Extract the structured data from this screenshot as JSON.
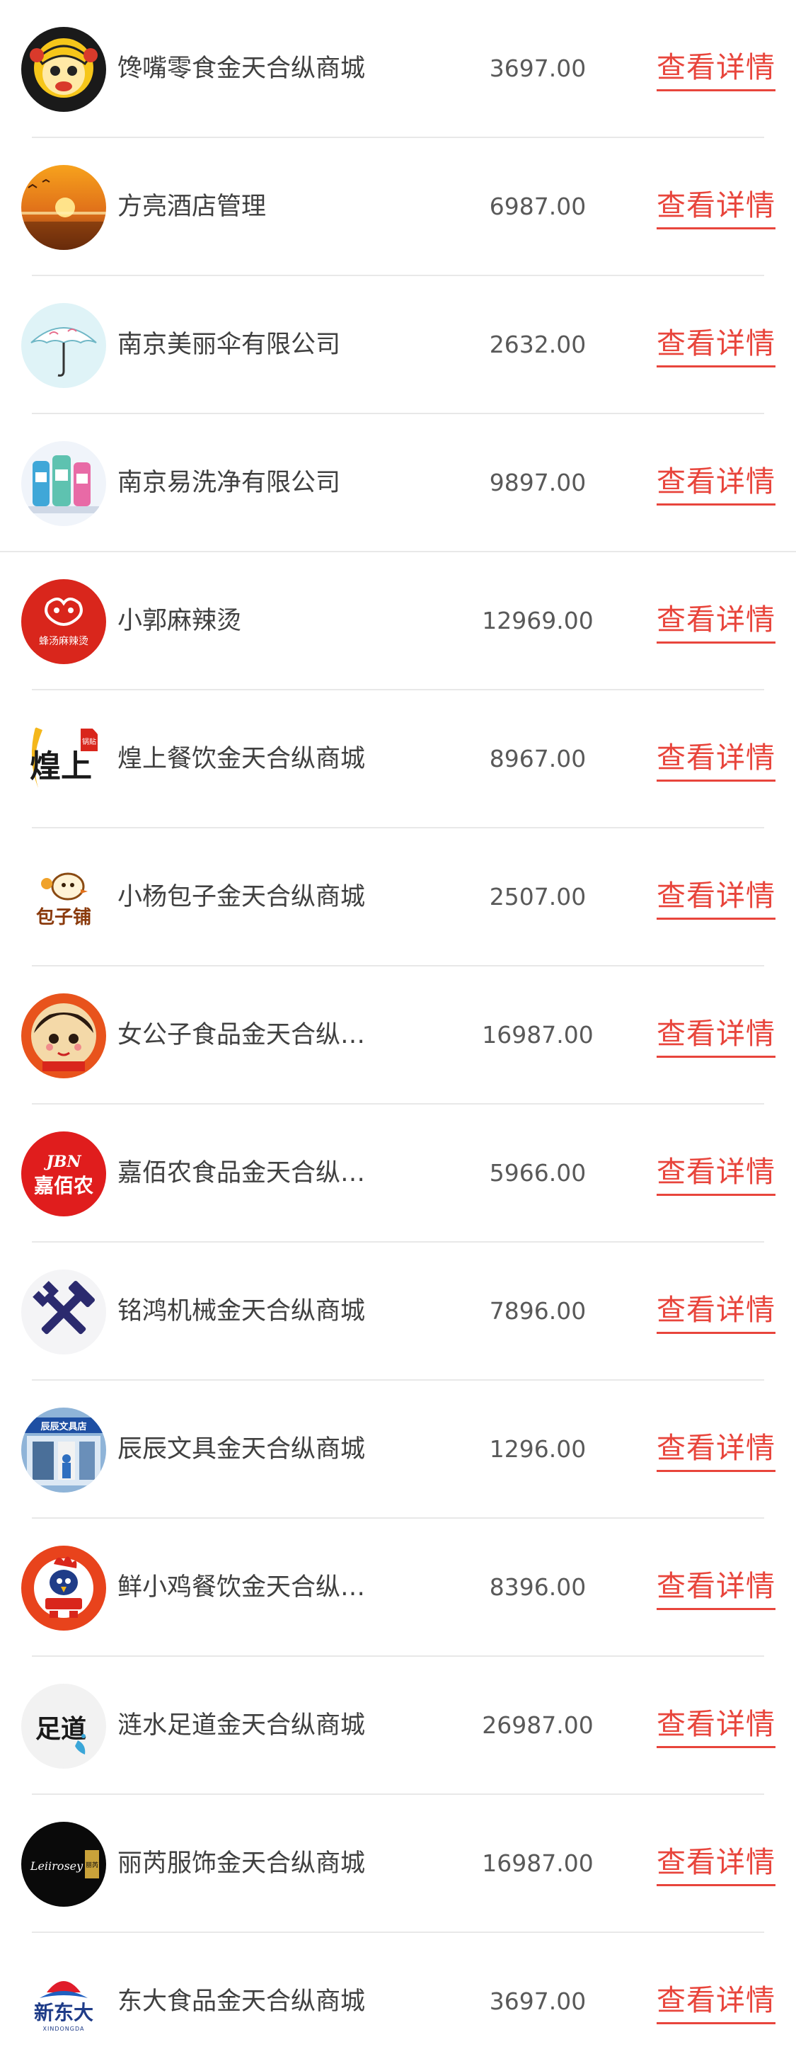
{
  "detail_label": "查看详情",
  "colors": {
    "accent": "#e8453c",
    "divider": "#e8e8e8",
    "name_text": "#404040",
    "amount_text": "#595959"
  },
  "merchants": [
    {
      "name": "馋嘴零食金天合纵商城",
      "amount": "3697.00",
      "logo": "cartoon-girl-logo"
    },
    {
      "name": "方亮酒店管理",
      "amount": "6987.00",
      "logo": "sunset-logo"
    },
    {
      "name": "南京美丽伞有限公司",
      "amount": "2632.00",
      "logo": "umbrella-logo"
    },
    {
      "name": "南京易洗净有限公司",
      "amount": "9897.00",
      "logo": "detergent-logo"
    },
    {
      "name": "小郭麻辣烫",
      "amount": "12969.00",
      "logo": "malatang-logo"
    },
    {
      "name": "煌上餐饮金天合纵商城",
      "amount": "8967.00",
      "logo": "huangshang-logo"
    },
    {
      "name": "小杨包子金天合纵商城",
      "amount": "2507.00",
      "logo": "baozi-logo"
    },
    {
      "name": "女公子食品金天合纵商城",
      "amount": "16987.00",
      "logo": "girl-face-logo"
    },
    {
      "name": "嘉佰农食品金天合纵商城",
      "amount": "5966.00",
      "logo": "jiabainong-logo"
    },
    {
      "name": "铭鸿机械金天合纵商城",
      "amount": "7896.00",
      "logo": "tools-logo"
    },
    {
      "name": "辰辰文具金天合纵商城",
      "amount": "1296.00",
      "logo": "stationery-store-logo"
    },
    {
      "name": "鲜小鸡餐饮金天合纵商城",
      "amount": "8396.00",
      "logo": "chicken-logo"
    },
    {
      "name": "涟水足道金天合纵商城",
      "amount": "26987.00",
      "logo": "foot-spa-logo"
    },
    {
      "name": "丽芮服饰金天合纵商城",
      "amount": "16987.00",
      "logo": "lirui-fashion-logo"
    },
    {
      "name": "东大食品金天合纵商城",
      "amount": "3697.00",
      "logo": "xindongda-logo"
    }
  ],
  "logo_text": {
    "malatang": "蜂汤麻辣烫",
    "huangshang_main": "煌上",
    "huangshang_seal": "锅贴",
    "baozi": "包子铺",
    "jiabainong_top": "JBN",
    "jiabainong": "嘉佰农",
    "stationery": "辰辰文具店",
    "foot_spa": "足道",
    "lirui_script": "Leiirosey",
    "lirui_cn": "丽芮",
    "xindongda": "新东大",
    "xindongda_pinyin": "XINDONGDA"
  }
}
